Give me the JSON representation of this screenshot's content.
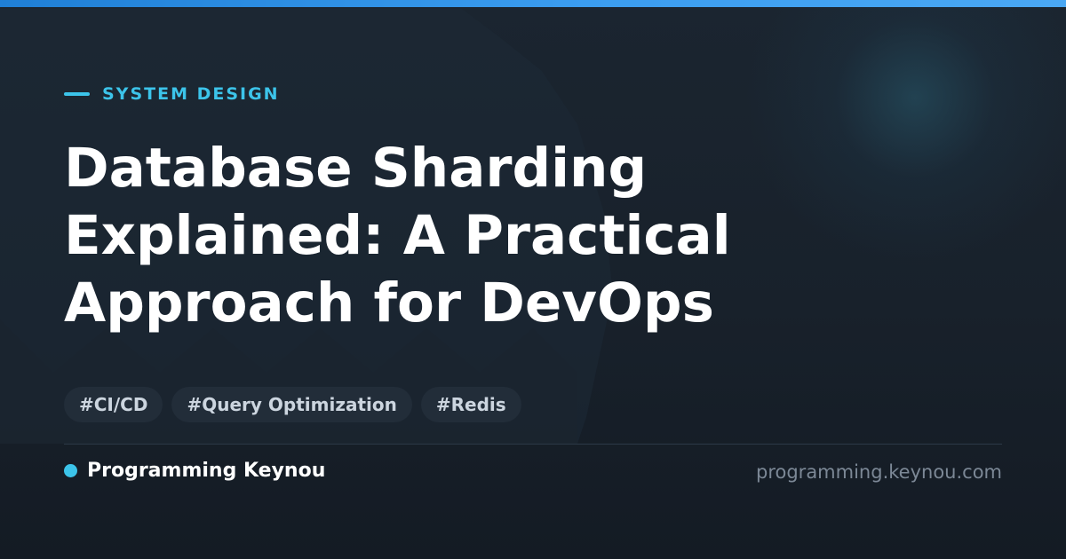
{
  "category": {
    "label": "SYSTEM DESIGN"
  },
  "title": {
    "lines": [
      "Database Sharding",
      "Explained: A Practical",
      "Approach for DevOps"
    ]
  },
  "tags": [
    "#CI/CD",
    "#Query Optimization",
    "#Redis"
  ],
  "brand": {
    "name": "Programming Keynou"
  },
  "site": {
    "url": "programming.keynou.com"
  },
  "colors": {
    "accent": "#3cc4ea",
    "top_bar": "#2f8fe6",
    "background": "#17202b",
    "text": "#ffffff",
    "muted": "#7c8896"
  }
}
